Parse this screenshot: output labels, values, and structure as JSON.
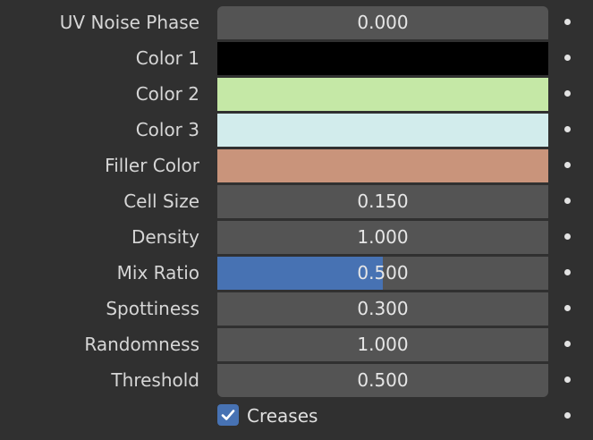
{
  "properties": [
    {
      "label": "UV Noise Phase",
      "kind": "number",
      "value": "0.000"
    },
    {
      "label": "Color 1",
      "kind": "color",
      "color": "#000000"
    },
    {
      "label": "Color 2",
      "kind": "color",
      "color": "#c5e8a6"
    },
    {
      "label": "Color 3",
      "kind": "color",
      "color": "#d2ecec"
    },
    {
      "label": "Filler Color",
      "kind": "color",
      "color": "#c9947b"
    },
    {
      "label": "Cell Size",
      "kind": "number",
      "value": "0.150"
    },
    {
      "label": "Density",
      "kind": "number",
      "value": "1.000"
    },
    {
      "label": "Mix Ratio",
      "kind": "slider",
      "value": "0.500",
      "fraction": 0.5
    },
    {
      "label": "Spottiness",
      "kind": "number",
      "value": "0.300"
    },
    {
      "label": "Randomness",
      "kind": "number",
      "value": "1.000"
    },
    {
      "label": "Threshold",
      "kind": "number",
      "value": "0.500"
    }
  ],
  "creases": {
    "label": "Creases",
    "checked": true
  },
  "colors": {
    "accent": "#4772b3",
    "field_bg": "#545454",
    "panel_bg": "#303030"
  }
}
